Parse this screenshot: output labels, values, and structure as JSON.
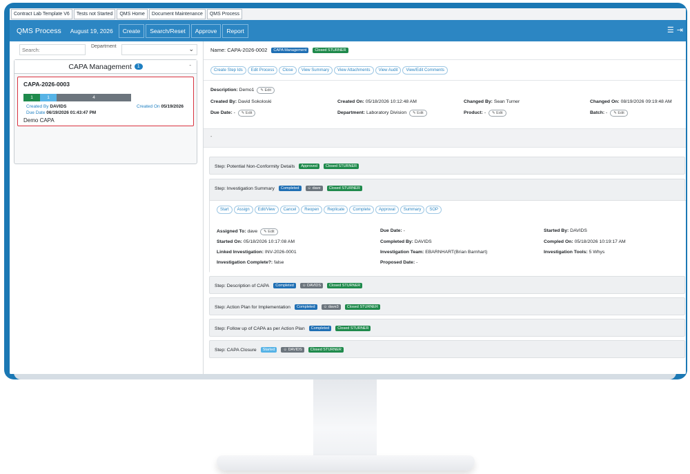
{
  "top_tabs": [
    "Contract Lab Template V6",
    "Tests not Started",
    "QMS Home",
    "Document Maintenance",
    "QMS Process"
  ],
  "navbar": {
    "title": "QMS Process",
    "date": "August 19, 2026",
    "buttons": [
      "Create",
      "Search/Reset",
      "Approve",
      "Report"
    ],
    "icons": [
      "menu-icon",
      "logout-icon"
    ]
  },
  "left": {
    "search_placeholder": "Search:",
    "department_label": "Department",
    "group": {
      "title": "CAPA Management",
      "count": "1",
      "collapse": "-"
    },
    "item": {
      "id": "CAPA-2026-0003",
      "progress": [
        {
          "label": "1",
          "color": "#1f8a4c",
          "fraction": 0.155
        },
        {
          "label": "1",
          "color": "#56b3e6",
          "fraction": 0.155
        },
        {
          "label": "4",
          "color": "#6c757d",
          "fraction": 0.69
        }
      ],
      "created_by_label": "Created By",
      "created_by": "DAVIDS",
      "created_on_label": "Created On",
      "created_on": "05/19/2026",
      "due_label": "Due Date",
      "due": "06/19/2026 01:43:47 PM",
      "description": "Demo CAPA"
    }
  },
  "record": {
    "name_label": "Name:",
    "name": "CAPA-2026-0002",
    "badges": [
      "CAPA Management",
      "Closed STURNER"
    ],
    "actions": [
      "Create Step Ids",
      "Edit Process",
      "Close",
      "View Summary",
      "View Attachments",
      "View Audit",
      "View/Edit Comments"
    ],
    "edit_label": "Edit",
    "fields": {
      "description_label": "Description:",
      "description": "Demo1",
      "created_by_label": "Created By:",
      "created_by": "David Sokoloski",
      "created_on_label": "Created On:",
      "created_on": "05/18/2026 10:12:48 AM",
      "changed_by_label": "Changed By:",
      "changed_by": "Sean Turner",
      "changed_on_label": "Changed On:",
      "changed_on": "08/19/2026 09:19:48 AM",
      "due_label": "Due Date:",
      "due": "-",
      "department_label": "Department:",
      "department": "Laboratory Division",
      "product_label": "Product:",
      "product": "-",
      "batch_label": "Batch:",
      "batch": "-"
    },
    "band_text": "-"
  },
  "steps": [
    {
      "title": "Step: Potential Non-Conformity Details",
      "badges": [
        {
          "text": "Approved",
          "kind": "green"
        },
        {
          "text": "Closed STURNER",
          "kind": "green"
        }
      ]
    },
    {
      "title": "Step: Investigation Summary",
      "badges": [
        {
          "text": "Completed",
          "kind": "blue"
        },
        {
          "text": "dave",
          "kind": "grey"
        },
        {
          "text": "Closed STURNER",
          "kind": "green"
        }
      ]
    },
    {
      "title": "Step: Description of CAPA",
      "badges": [
        {
          "text": "Completed",
          "kind": "blue"
        },
        {
          "text": "DAVIDS",
          "kind": "grey"
        },
        {
          "text": "Closed STURNER",
          "kind": "green"
        }
      ]
    },
    {
      "title": "Step: Action Plan for Implementation",
      "badges": [
        {
          "text": "Completed",
          "kind": "blue"
        },
        {
          "text": "dave3",
          "kind": "grey"
        },
        {
          "text": "Closed STURNER",
          "kind": "green"
        }
      ]
    },
    {
      "title": "Step: Follow up of CAPA as per Action Plan",
      "badges": [
        {
          "text": "Completed",
          "kind": "blue"
        },
        {
          "text": "Closed STURNER",
          "kind": "green"
        }
      ]
    },
    {
      "title": "Step: CAPA Closure",
      "badges": [
        {
          "text": "Started",
          "kind": "lightblue"
        },
        {
          "text": "DAVIDS",
          "kind": "grey"
        },
        {
          "text": "Closed STURNER",
          "kind": "green"
        }
      ]
    }
  ],
  "investigation": {
    "actions": [
      "Start",
      "Assign",
      "Edit/View",
      "Cancel",
      "Reopen",
      "Replicate",
      "Complete",
      "Approval",
      "Summary",
      "SOP"
    ],
    "assigned_label": "Assigned To:",
    "assigned": "dave",
    "due_label": "Due Date:",
    "due": "-",
    "started_by_label": "Started By:",
    "started_by": "DAVIDS",
    "started_on_label": "Started On:",
    "started_on": "05/18/2026 10:17:08 AM",
    "completed_by_label": "Completed By:",
    "completed_by": "DAVIDS",
    "completed_on_label": "Compled On:",
    "completed_on": "05/18/2026 10:19:17 AM",
    "linked_label": "Linked Investigation:",
    "linked": "INV-2026-0001",
    "team_label": "Investigation Team:",
    "team": "EBARNHART(Brian Barnhart)",
    "tools_label": "Investigation Tools:",
    "tools": "5 Whys",
    "complete_label": "Investigation Complete?:",
    "complete": "false",
    "proposed_label": "Proposed Date:",
    "proposed": "-"
  },
  "colors": {
    "navbar": "#2c86c3",
    "bezel": "#1b78b4",
    "green": "#1f8a4c",
    "blue": "#1f6fb4",
    "selected_border": "#d9323f"
  }
}
